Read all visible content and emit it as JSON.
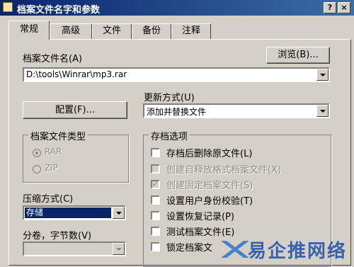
{
  "window": {
    "title": "档案文件名字和参数",
    "help_label": "?",
    "close_label": "×"
  },
  "tabs": [
    {
      "label": "常规"
    },
    {
      "label": "高级"
    },
    {
      "label": "文件"
    },
    {
      "label": "备份"
    },
    {
      "label": "注释"
    }
  ],
  "archive_name": {
    "label": "档案文件名(A)",
    "browse_label": "浏览(B)...",
    "value": "D:\\tools\\Winrar\\mp3.rar"
  },
  "update_mode": {
    "label": "更新方式(U)",
    "value": "添加并替换文件"
  },
  "config_label": "配置(F)...",
  "archive_type": {
    "label": "档案文件类型",
    "options": [
      {
        "label": "RAR",
        "selected": true
      },
      {
        "label": "ZIP",
        "selected": false
      }
    ]
  },
  "compression": {
    "label": "压缩方式(C)",
    "value": "存储"
  },
  "volumes": {
    "label": "分卷，字节数(V)",
    "value": ""
  },
  "archive_options": {
    "label": "存档选项",
    "items": [
      {
        "label": "存档后删除原文件(L)",
        "checked": false,
        "enabled": true
      },
      {
        "label": "创建自释放格式档案文件(X)",
        "checked": false,
        "enabled": false
      },
      {
        "label": "创建固定档案文件(S)",
        "checked": true,
        "enabled": false
      },
      {
        "label": "设置用户身份校验(T)",
        "checked": false,
        "enabled": true
      },
      {
        "label": "设置恢复记录(P)",
        "checked": false,
        "enabled": true
      },
      {
        "label": "测试档案文件(E)",
        "checked": false,
        "enabled": true
      },
      {
        "label": "锁定档案文",
        "checked": false,
        "enabled": true
      }
    ]
  },
  "watermark": {
    "text": "易企推网络"
  },
  "colors": {
    "titlebar": "#0a246a",
    "face": "#d4d0c8",
    "selection": "#0a246a",
    "watermark": "#1e4fa8"
  }
}
